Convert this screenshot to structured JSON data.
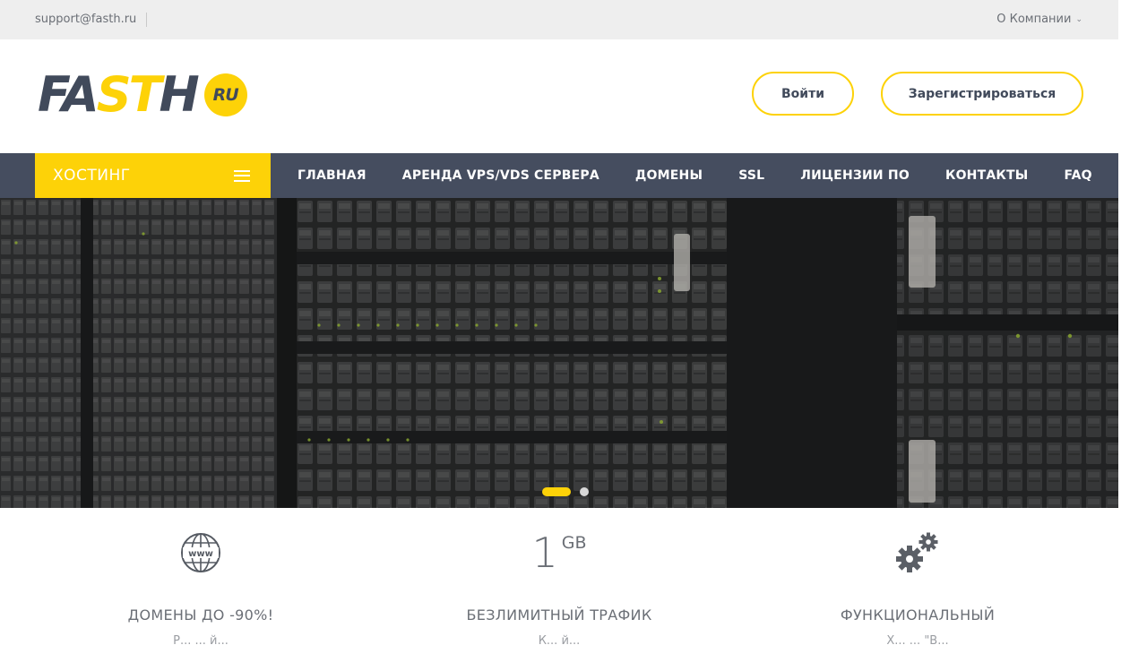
{
  "topbar": {
    "email": "support@fasth.ru",
    "company_menu": "О Компании",
    "company_menu_icon": "chevron-down-icon"
  },
  "header": {
    "logo": {
      "text_dark": "FA",
      "text_yellow": "ST",
      "text_dark2": "H",
      "badge": "RU"
    },
    "login_label": "Войти",
    "register_label": "Зарегистрироваться"
  },
  "nav": {
    "hosting_label": "ХОСТИНГ",
    "hosting_icon": "hamburger-menu-icon",
    "items": [
      "ГЛАВНАЯ",
      "АРЕНДА VPS/VDS СЕРВЕРА",
      "ДОМЕНЫ",
      "SSL",
      "ЛИЦЕНЗИИ ПО",
      "КОНТАКТЫ",
      "FAQ"
    ]
  },
  "hero": {
    "image": "server-racks-photo",
    "slides": 2,
    "active_slide": 1
  },
  "features": [
    {
      "icon": "www-globe-icon",
      "title": "ДОМЕНЫ ДО -90%!",
      "sub": "Р... ... й..."
    },
    {
      "icon": "gb-counter",
      "value": "1",
      "unit": "GB",
      "title": "БЕЗЛИМИТНЫЙ ТРАФИК",
      "sub": "К... й..."
    },
    {
      "icon": "gears-icon",
      "title": "ФУНКЦИОНАЛЬНЫЙ",
      "sub": "Х... ... \"В..."
    }
  ],
  "colors": {
    "accent": "#fdd208",
    "nav_bg": "#454d5f",
    "topbar_bg": "#eeeeee",
    "text_dark": "#414a5b"
  }
}
